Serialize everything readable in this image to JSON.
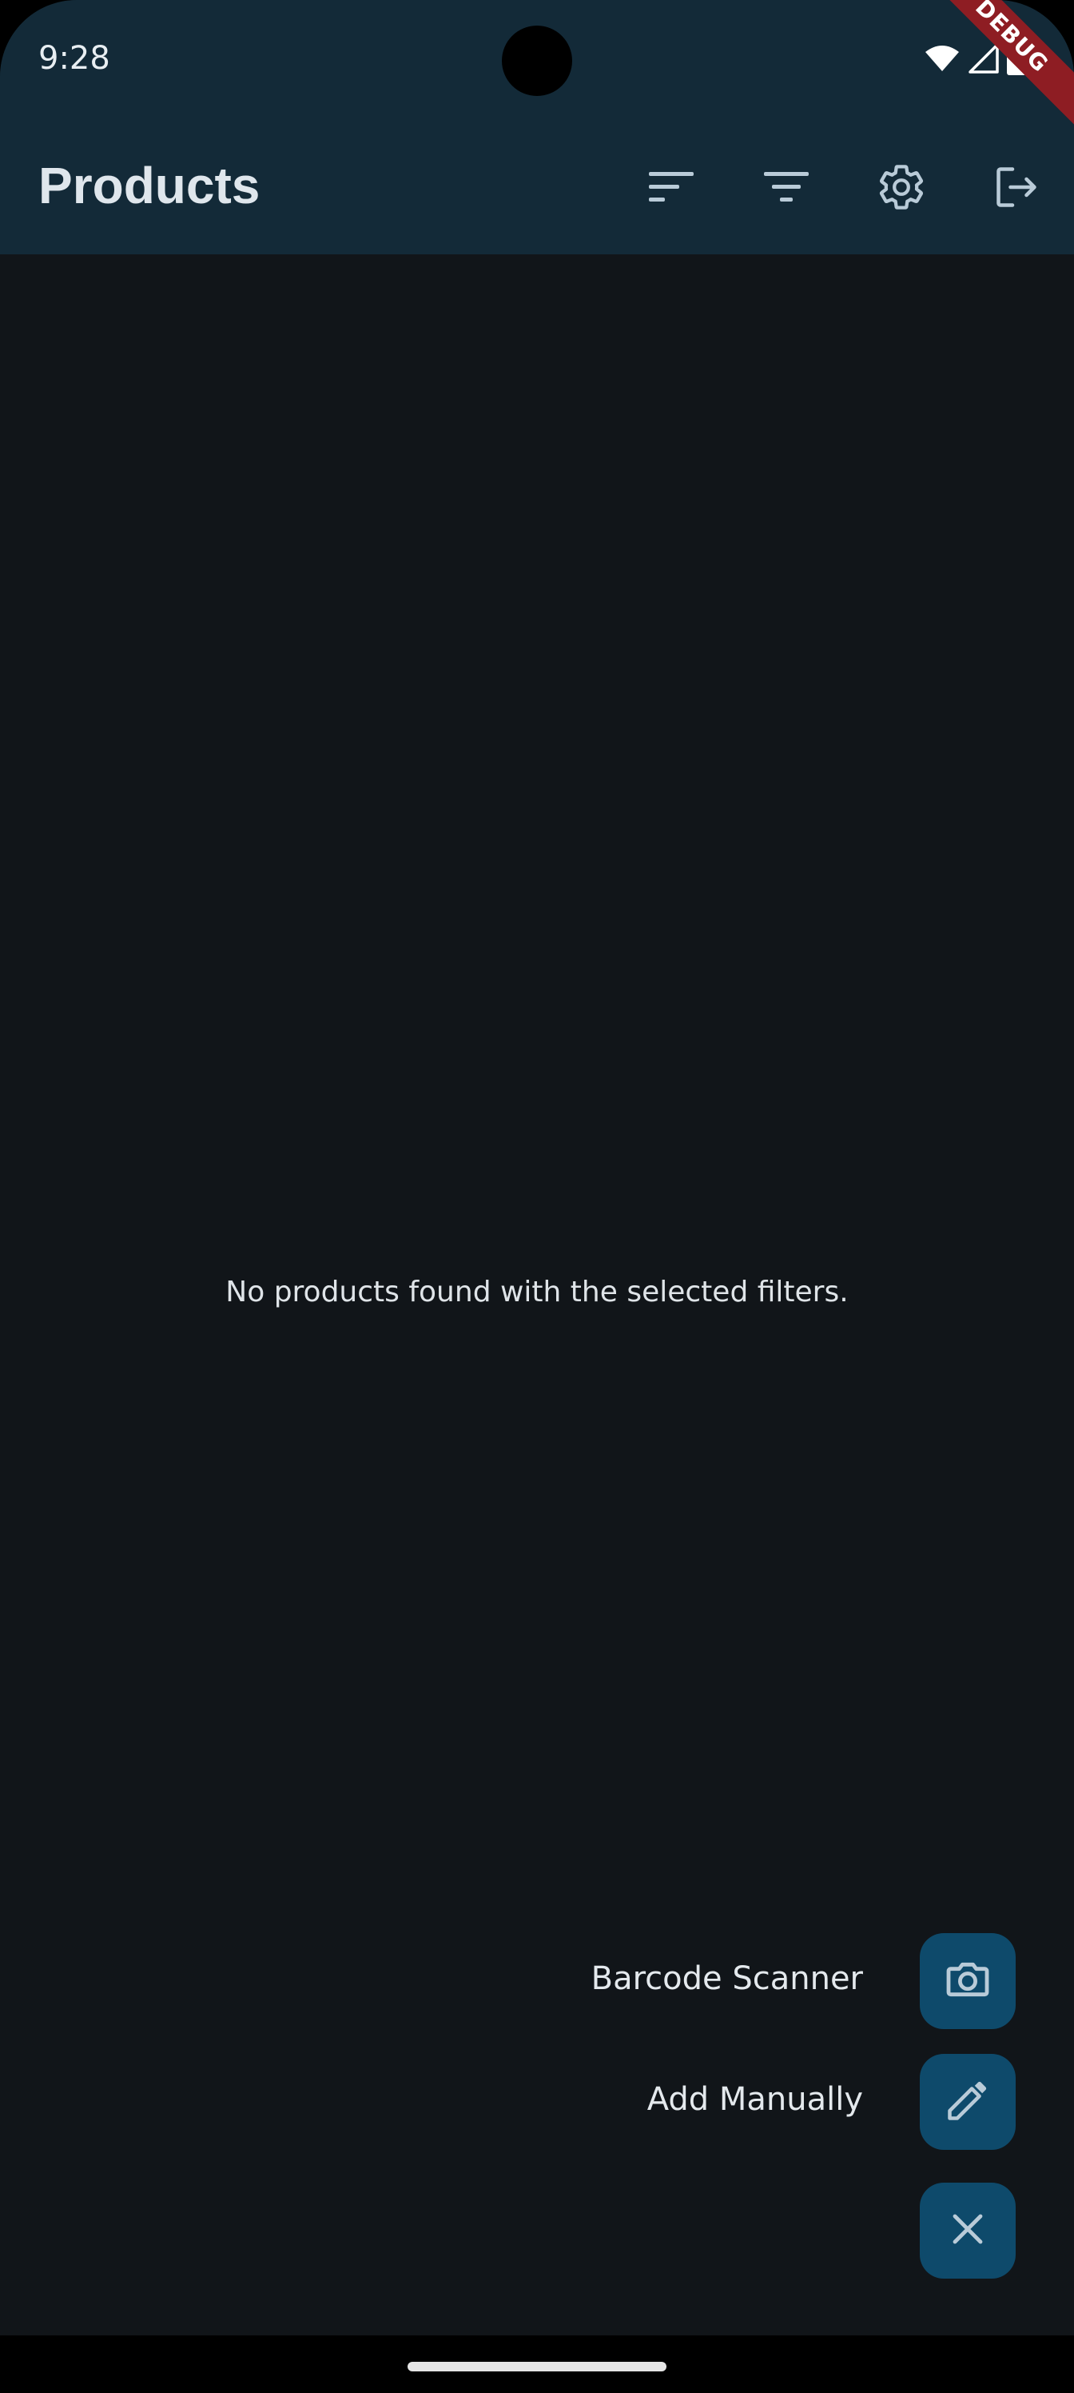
{
  "status_bar": {
    "time": "9:28",
    "icons": [
      "wifi-icon",
      "signal-icon",
      "battery-icon"
    ]
  },
  "debug_banner": "DEBUG",
  "app_bar": {
    "title": "Products",
    "actions": [
      "sort-icon",
      "filter-icon",
      "settings-icon",
      "logout-icon"
    ]
  },
  "main": {
    "empty_message": "No products found with the selected filters."
  },
  "speed_dial": {
    "items": [
      {
        "label": "Barcode Scanner",
        "icon": "camera-icon"
      },
      {
        "label": "Add Manually",
        "icon": "pencil-icon"
      }
    ],
    "close_icon": "close-icon"
  },
  "colors": {
    "background": "#111519",
    "app_bar": "#132a38",
    "fab": "#0e4a6b",
    "icon": "#b9cbd8",
    "debug_banner": "#8e1d23"
  }
}
